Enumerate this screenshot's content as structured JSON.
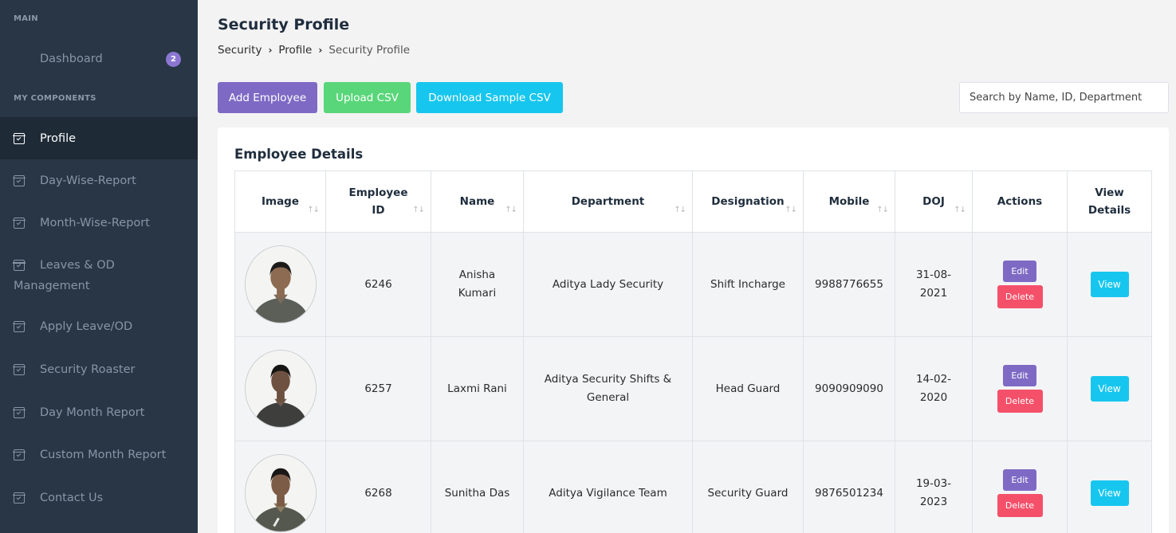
{
  "sidebar": {
    "section_main": "MAIN",
    "section_components": "MY COMPONENTS",
    "dashboard": {
      "label": "Dashboard",
      "badge": "2"
    },
    "items": [
      {
        "label": "Profile",
        "active": true
      },
      {
        "label": "Day-Wise-Report"
      },
      {
        "label": "Month-Wise-Report"
      },
      {
        "label_line1": "Leaves & OD",
        "label_line2": "Management"
      },
      {
        "label": "Apply Leave/OD"
      },
      {
        "label": "Security Roaster"
      },
      {
        "label": "Day Month Report"
      },
      {
        "label": "Custom Month Report"
      },
      {
        "label": "Contact Us"
      }
    ]
  },
  "header": {
    "title": "Security Profile",
    "breadcrumb": [
      "Security",
      "Profile",
      "Security Profile"
    ]
  },
  "toolbar": {
    "add_label": "Add Employee",
    "upload_label": "Upload CSV",
    "download_label": "Download Sample CSV",
    "search_placeholder": "Search by Name, ID, Department"
  },
  "table": {
    "title": "Employee Details",
    "columns": [
      {
        "line1": "Image",
        "sortable": true
      },
      {
        "line1": "Employee",
        "line2": "ID",
        "sortable": true
      },
      {
        "line1": "Name",
        "sortable": true
      },
      {
        "line1": "Department",
        "sortable": true
      },
      {
        "line1": "Designation",
        "sortable": true
      },
      {
        "line1": "Mobile",
        "sortable": true
      },
      {
        "line1": "DOJ",
        "sortable": true
      },
      {
        "line1": "Actions",
        "sortable": false
      },
      {
        "line1": "View",
        "line2": "Details",
        "sortable": false
      }
    ],
    "rows": [
      {
        "id": "6246",
        "name_line1": "Anisha",
        "name_line2": "Kumari",
        "department_line1": "Aditya Lady Security",
        "department_line2": "",
        "designation": "Shift Incharge",
        "mobile": "9988776655",
        "doj_line1": "31-08-",
        "doj_line2": "2021"
      },
      {
        "id": "6257",
        "name_line1": "Laxmi Rani",
        "name_line2": "",
        "department_line1": "Aditya Security Shifts &",
        "department_line2": "General",
        "designation": "Head Guard",
        "mobile": "9090909090",
        "doj_line1": "14-02-",
        "doj_line2": "2020"
      },
      {
        "id": "6268",
        "name_line1": "Sunitha Das",
        "name_line2": "",
        "department_line1": "Aditya Vigilance Team",
        "department_line2": "",
        "designation": "Security Guard",
        "mobile": "9876501234",
        "doj_line1": "19-03-",
        "doj_line2": "2023"
      }
    ],
    "sort_glyph": "↑↓",
    "edit_label": "Edit",
    "delete_label": "Delete",
    "view_label": "View"
  },
  "colors": {
    "sidebar_bg": "#283645",
    "sidebar_active_bg": "#1e2a36",
    "primary_purple": "#7e6ac4",
    "success_green": "#59d679",
    "info_cyan": "#17c6ee",
    "danger_red": "#f5506a"
  },
  "icons": {
    "dashboard": "grid-icon",
    "menu_item": "calendar-check-icon",
    "breadcrumb_separator": "chevron-right-icon",
    "sort": "sort-arrows-icon"
  }
}
